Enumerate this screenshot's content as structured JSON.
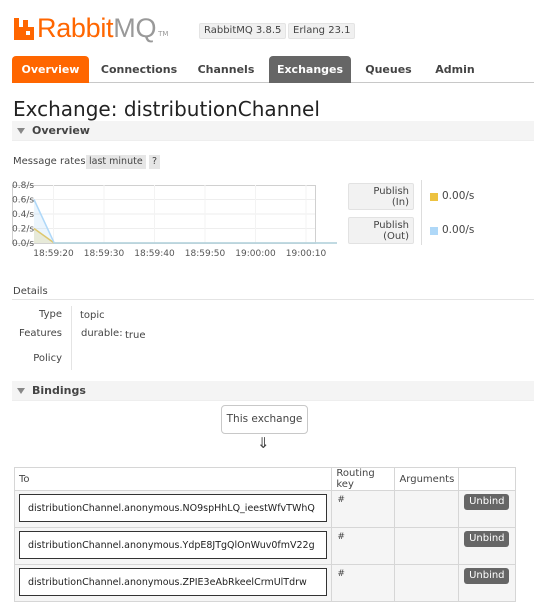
{
  "header": {
    "logo_rabbit": "Rabbit",
    "logo_mq": "MQ",
    "logo_tm": "TM",
    "rabbitmq_version": "RabbitMQ 3.8.5",
    "erlang_version": "Erlang 23.1"
  },
  "tabs": [
    {
      "label": "Overview"
    },
    {
      "label": "Connections"
    },
    {
      "label": "Channels"
    },
    {
      "label": "Exchanges"
    },
    {
      "label": "Queues"
    },
    {
      "label": "Admin"
    }
  ],
  "page": {
    "title": "Exchange: distributionChannel",
    "overview_section": "Overview",
    "bindings_section": "Bindings"
  },
  "rates": {
    "label": "Message rates",
    "period": "last minute",
    "help": "?"
  },
  "chart_data": {
    "type": "line",
    "x": [
      "18:59:20",
      "18:59:30",
      "18:59:40",
      "18:59:50",
      "19:00:00",
      "19:00:10"
    ],
    "y_ticks": [
      "0.8/s",
      "0.6/s",
      "0.4/s",
      "0.2/s",
      "0.0/s"
    ],
    "ylim": [
      0,
      0.8
    ],
    "grid": true,
    "series": [
      {
        "name": "Publish (In)",
        "color": "#edc240",
        "points": [
          [
            0,
            0.2
          ],
          [
            4,
            0.0
          ],
          [
            60,
            0.0
          ]
        ]
      },
      {
        "name": "Publish (Out)",
        "color": "#afd8f8",
        "points": [
          [
            0,
            0.6
          ],
          [
            4,
            0.0
          ],
          [
            60,
            0.0
          ]
        ]
      }
    ]
  },
  "legend": {
    "in_line1": "Publish",
    "in_line2": "(In)",
    "in_value": "0.00/s",
    "in_color": "#edc240",
    "out_line1": "Publish",
    "out_line2": "(Out)",
    "out_value": "0.00/s",
    "out_color": "#afd8f8"
  },
  "details": {
    "label": "Details",
    "type_key": "Type",
    "type_value": "topic",
    "features_key": "Features",
    "durable_key": "durable:",
    "durable_value": "true",
    "policy_key": "Policy",
    "policy_value": ""
  },
  "bindings": {
    "this_exchange": "This exchange",
    "arrow": "⇓",
    "columns": {
      "to": "To",
      "routing_key": "Routing key",
      "arguments": "Arguments"
    },
    "rows": [
      {
        "to": "distributionChannel.anonymous.NO9spHhLQ_ieestWfvTWhQ",
        "routing_key": "#",
        "arguments": "",
        "action": "Unbind"
      },
      {
        "to": "distributionChannel.anonymous.YdpE8JTgQlOnWuv0fmV22g",
        "routing_key": "#",
        "arguments": "",
        "action": "Unbind"
      },
      {
        "to": "distributionChannel.anonymous.ZPIE3eAbRkeelCrmUlTdrw",
        "routing_key": "#",
        "arguments": "",
        "action": "Unbind"
      }
    ]
  }
}
